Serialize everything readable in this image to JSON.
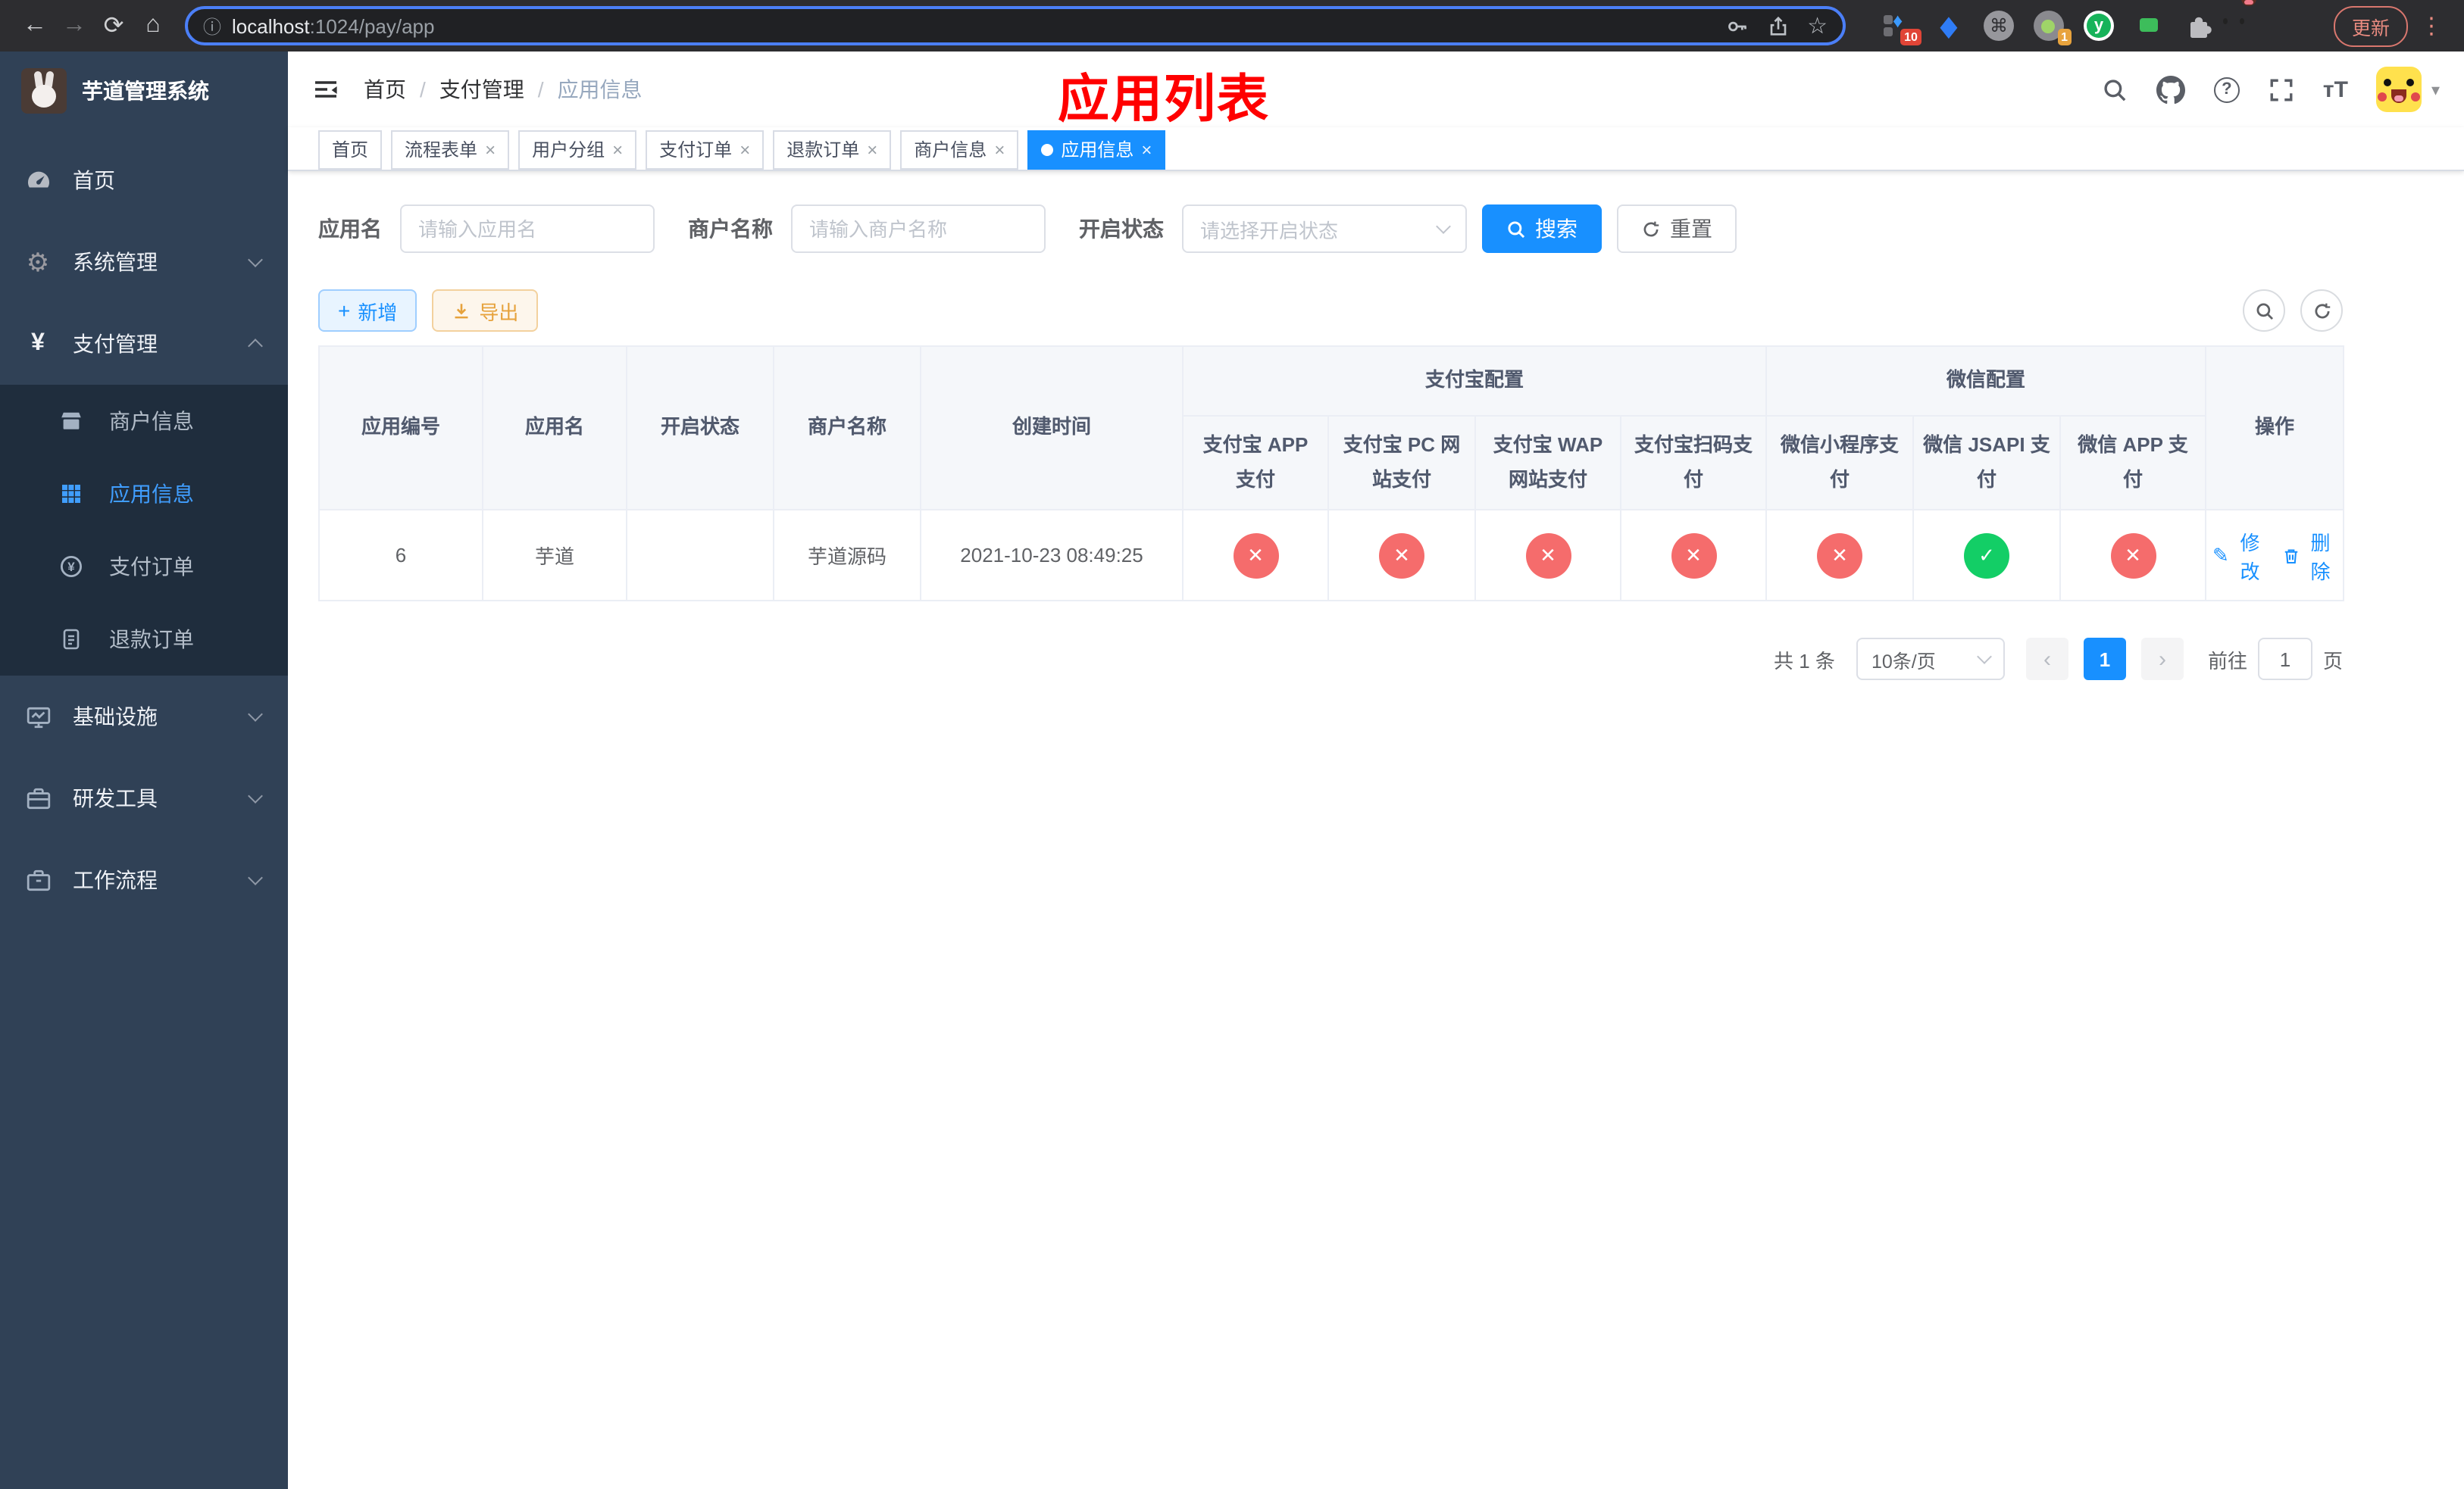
{
  "colors": {
    "accent": "#1890ff",
    "sidebar_bg": "#304156",
    "submenu_bg": "#1f2d3d",
    "sidebar_active": "#409eff",
    "danger": "#f56c6c",
    "success": "#13ce66",
    "warning": "#e6a23c",
    "annotation_red": "#ff0000"
  },
  "icons": {
    "back": "←",
    "forward": "→",
    "reload": "⟳",
    "home": "⌂",
    "info": "ⓘ",
    "star": "☆",
    "command": "⌘",
    "menu_dots": "⋮",
    "gear": "⚙",
    "yen": "¥",
    "plus": "+",
    "close": "×",
    "check": "✓",
    "cross": "✕",
    "question": "?",
    "font_size": "тT",
    "caret_down": "▾",
    "pencil": "✎",
    "prev": "‹",
    "next": "›",
    "breadcrumb_separator": "/"
  },
  "browser": {
    "url_host": "localhost",
    "url_path": ":1024/pay/app",
    "extension_badge_a": "10",
    "extension_badge_b": "1",
    "extension_y": "y",
    "update_label": "更新"
  },
  "sidebar": {
    "title": "芋道管理系统",
    "items": [
      {
        "label": "首页"
      },
      {
        "label": "系统管理"
      },
      {
        "label": "支付管理"
      },
      {
        "label": "商户信息"
      },
      {
        "label": "应用信息"
      },
      {
        "label": "支付订单"
      },
      {
        "label": "退款订单"
      },
      {
        "label": "基础设施"
      },
      {
        "label": "研发工具"
      },
      {
        "label": "工作流程"
      }
    ]
  },
  "nav": {
    "breadcrumb": [
      "首页",
      "支付管理",
      "应用信息"
    ],
    "annotation": "应用列表"
  },
  "tabs": [
    {
      "label": "首页"
    },
    {
      "label": "流程表单"
    },
    {
      "label": "用户分组"
    },
    {
      "label": "支付订单"
    },
    {
      "label": "退款订单"
    },
    {
      "label": "商户信息"
    },
    {
      "label": "应用信息"
    }
  ],
  "filters": {
    "app_name_label": "应用名",
    "app_name_placeholder": "请输入应用名",
    "merchant_label": "商户名称",
    "merchant_placeholder": "请输入商户名称",
    "status_label": "开启状态",
    "status_placeholder": "请选择开启状态",
    "search_label": "搜索",
    "reset_label": "重置"
  },
  "toolbar": {
    "add_label": "新增",
    "export_label": "导出"
  },
  "table": {
    "headers": [
      "应用编号",
      "应用名",
      "开启状态",
      "商户名称",
      "创建时间"
    ],
    "groups": {
      "alipay": "支付宝配置",
      "wechat": "微信配置"
    },
    "sub_headers": [
      "支付宝 APP 支付",
      "支付宝 PC 网站支付",
      "支付宝 WAP 网站支付",
      "支付宝扫码支付",
      "微信小程序支付",
      "微信 JSAPI 支付",
      "微信 APP 支付"
    ],
    "action_header": "操作",
    "row": {
      "id": "6",
      "name": "芋道",
      "enabled": true,
      "merchant": "芋道源码",
      "created_at": "2021-10-23 08:49:25",
      "statuses": [
        "no",
        "no",
        "no",
        "no",
        "no",
        "yes",
        "no"
      ],
      "edit_label": "修改",
      "delete_label": "删除"
    }
  },
  "pagination": {
    "total": "共 1 条",
    "page_size": "10条/页",
    "current_page": "1",
    "goto_label": "前往",
    "goto_value": "1",
    "unit_label": "页"
  }
}
